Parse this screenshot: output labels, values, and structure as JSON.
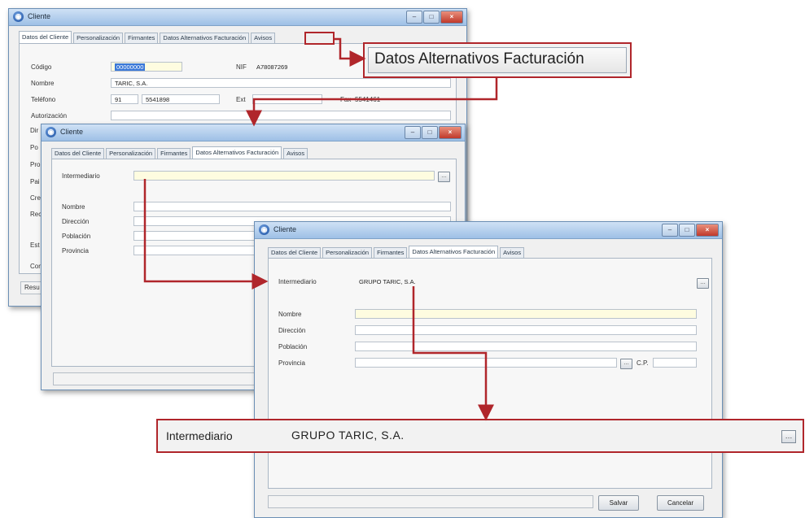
{
  "window_title": "Cliente",
  "tabs": [
    "Datos del Cliente",
    "Personalización",
    "Firmantes",
    "Datos Alternativos Facturación",
    "Avisos"
  ],
  "win1": {
    "codigo_label": "Código",
    "codigo_value": "00000000",
    "nif_label": "NIF",
    "nif_value": "A78087269",
    "nombre_label": "Nombre",
    "nombre_value": "TARIC, S.A.",
    "telefono_label": "Teléfono",
    "telefono_prefix": "91",
    "telefono_value": "5541898",
    "ext_label": "Ext",
    "fax_label": "Fax",
    "fax_value": "5541461",
    "autorizacion_label": "Autorización",
    "partial_labels": [
      "Dir",
      "Po",
      "Pro",
      "Pai",
      "Cre",
      "Rec",
      "Est",
      "Cor"
    ],
    "status_text": "Resu"
  },
  "win2": {
    "intermediario_label": "Intermediario",
    "nombre_label": "Nombre",
    "direccion_label": "Dirección",
    "poblacion_label": "Población",
    "provincia_label": "Provincia"
  },
  "win3": {
    "intermediario_label": "Intermediario",
    "intermediario_value": "GRUPO TARIC, S.A.",
    "nombre_label": "Nombre",
    "direccion_label": "Dirección",
    "poblacion_label": "Población",
    "provincia_label": "Provincia",
    "cp_label": "C.P.",
    "save_label": "Salvar",
    "cancel_label": "Cancelar"
  },
  "callout_tab": {
    "label": "Datos Alternativos Facturación"
  },
  "callout_field": {
    "label": "Intermediario",
    "value": "GRUPO TARIC, S.A."
  },
  "colors": {
    "arrow": "#b0262b",
    "field_highlight": "#fefce0",
    "titlebar": "#9ec0e6"
  }
}
